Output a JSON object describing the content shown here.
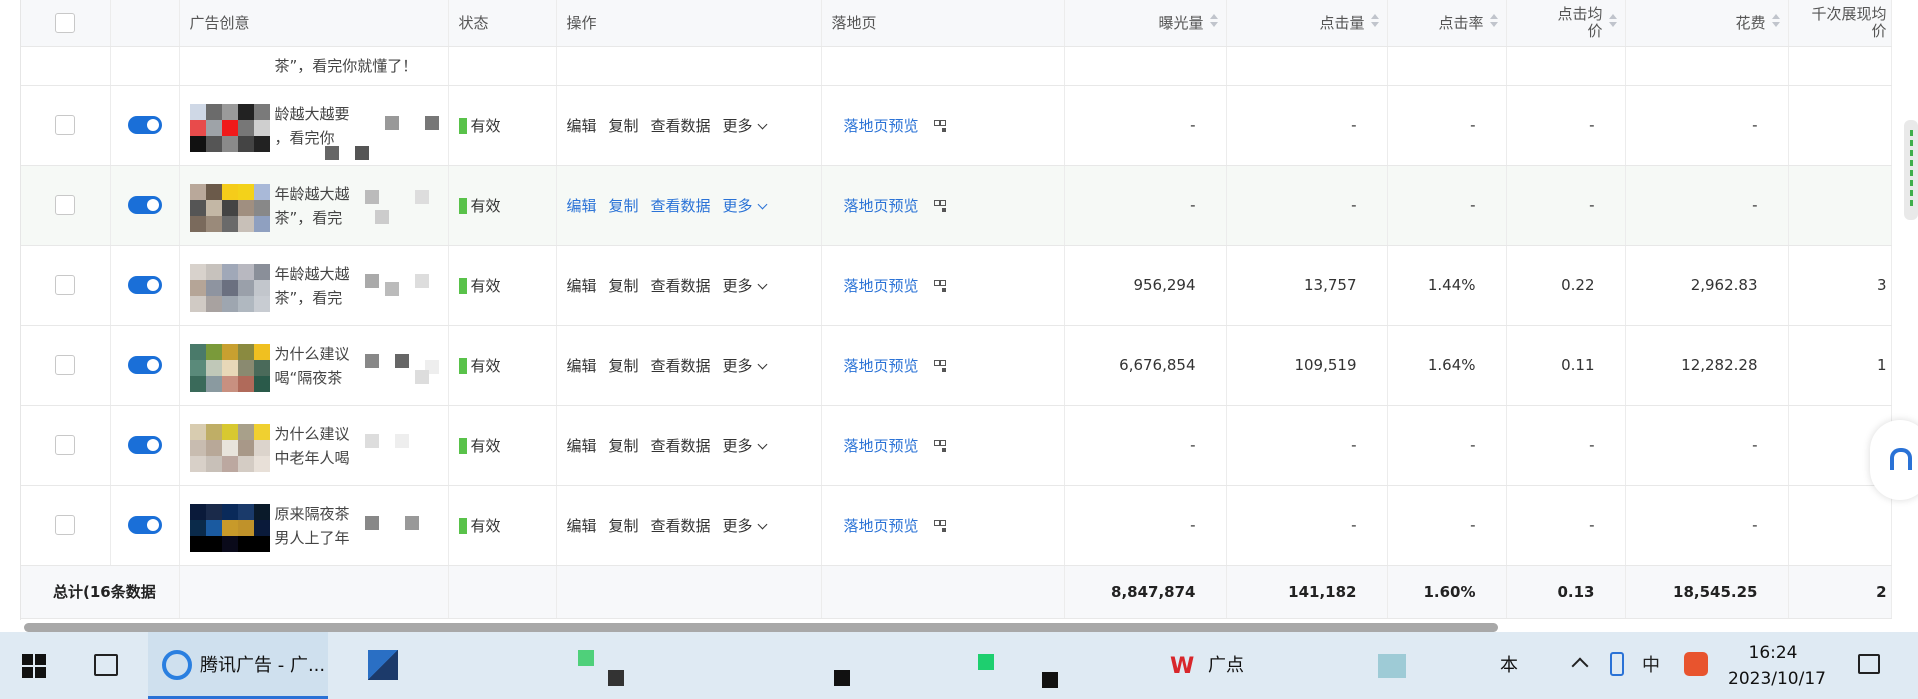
{
  "table": {
    "headers": {
      "creative": "广告创意",
      "status": "状态",
      "actions": "操作",
      "landing": "落地页",
      "impressions": "曝光量",
      "clicks": "点击量",
      "ctr": "点击率",
      "cpc_line1": "点击均",
      "cpc_line2": "价",
      "cost": "花费",
      "cpm_line1": "千次展现均",
      "cpm_line2": "价"
    },
    "partial_row_text": "茶”，看完你就懂了！",
    "rows": [
      {
        "line1": "龄越大越要",
        "line2": "，看完你",
        "status": "有效",
        "impressions": "-",
        "clicks": "-",
        "ctr": "-",
        "cpc": "-",
        "cost": "-",
        "cpm": ""
      },
      {
        "line1": "年龄越大越",
        "line2": "茶”，看完",
        "status": "有效",
        "impressions": "-",
        "clicks": "-",
        "ctr": "-",
        "cpc": "-",
        "cost": "-",
        "cpm": ""
      },
      {
        "line1": "年龄越大越",
        "line2": "茶”，看完",
        "status": "有效",
        "impressions": "956,294",
        "clicks": "13,757",
        "ctr": "1.44%",
        "cpc": "0.22",
        "cost": "2,962.83",
        "cpm": "3"
      },
      {
        "line1": "为什么建议",
        "line2": "喝“隔夜茶",
        "status": "有效",
        "impressions": "6,676,854",
        "clicks": "109,519",
        "ctr": "1.64%",
        "cpc": "0.11",
        "cost": "12,282.28",
        "cpm": "1"
      },
      {
        "line1": "为什么建议",
        "line2": "中老年人喝",
        "status": "有效",
        "impressions": "-",
        "clicks": "-",
        "ctr": "-",
        "cpc": "-",
        "cost": "-",
        "cpm": ""
      },
      {
        "line1": "原来隔夜茶",
        "line2": "男人上了年",
        "status": "有效",
        "impressions": "-",
        "clicks": "-",
        "ctr": "-",
        "cpc": "-",
        "cost": "-",
        "cpm": ""
      }
    ],
    "action_labels": {
      "edit": "编辑",
      "copy": "复制",
      "view_data": "查看数据",
      "more": "更多"
    },
    "landing_label": "落地页预览",
    "total": {
      "label": "总计(16条数据",
      "impressions": "8,847,874",
      "clicks": "141,182",
      "ctr": "1.60%",
      "cpc": "0.13",
      "cost": "18,545.25",
      "cpm": "2"
    }
  },
  "taskbar": {
    "active_app": "腾讯广告 - 广...",
    "wps_app": "广点",
    "partial_app": "本",
    "ime": "中",
    "time": "16:24",
    "date": "2023/10/17"
  },
  "colors": {
    "accent": "#2a72d6",
    "status_green": "#59c24a",
    "taskbar": "#dfeaf3"
  },
  "icons": [
    "windows-start-icon",
    "task-view-icon",
    "qr-code-icon",
    "chevron-down-icon",
    "sort-icon",
    "notification-icon"
  ]
}
